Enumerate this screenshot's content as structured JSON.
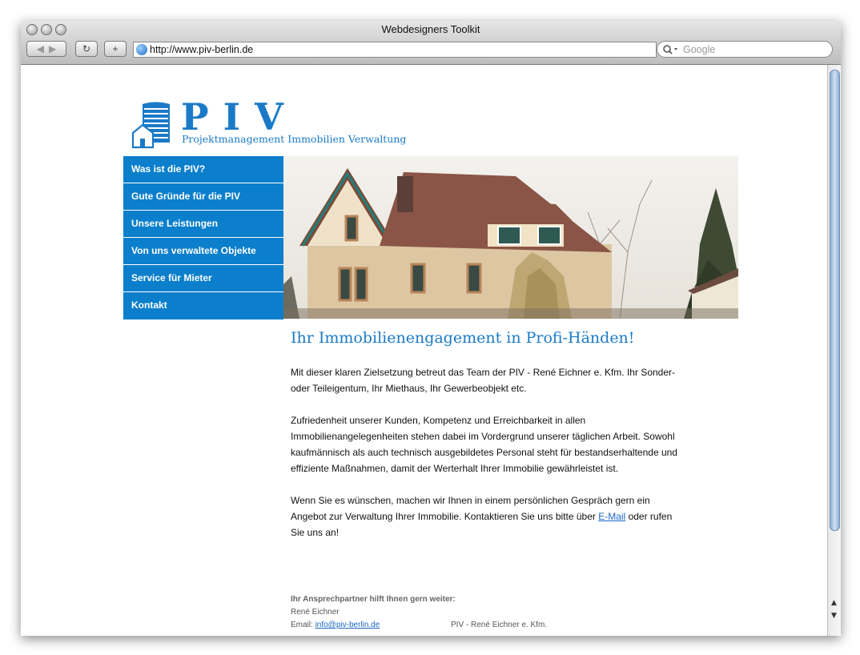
{
  "window": {
    "title": "Webdesigners Toolkit"
  },
  "toolbar": {
    "back_label": "◀",
    "forward_label": "▶",
    "reload_label": "↻",
    "add_label": "+",
    "url": "http://www.piv-berlin.de",
    "search_placeholder": "Google"
  },
  "logo": {
    "name": "PIV",
    "subtitle": "Projektmanagement Immobilien Verwaltung"
  },
  "nav": {
    "items": [
      {
        "label": "Was ist die PIV?"
      },
      {
        "label": "Gute Gründe für die PIV"
      },
      {
        "label": "Unsere Leistungen"
      },
      {
        "label": "Von uns verwaltete Objekte"
      },
      {
        "label": "Service für Mieter"
      },
      {
        "label": "Kontakt"
      }
    ]
  },
  "main": {
    "headline": "Ihr Immobilienengagement in Profi-Händen!",
    "para1": "Mit dieser klaren Zielsetzung betreut das Team der PIV - René Eichner e. Kfm. Ihr Sonder- oder Teileigentum, Ihr Miethaus, Ihr Gewerbeobjekt etc.",
    "para2": "Zufriedenheit unserer Kunden, Kompetenz und Erreichbarkeit in allen Immobilienangelegenheiten stehen dabei im Vordergrund unserer täglichen Arbeit. Sowohl kaufmännisch als auch technisch ausgebildetes Personal steht für bestandserhaltende und effiziente Maßnahmen, damit der Werterhalt Ihrer Immobilie gewährleistet ist.",
    "para3_before": "Wenn Sie es wünschen, machen wir Ihnen in einem persönlichen Gespräch gern ein Angebot zur Verwaltung Ihrer Immobilie. Kontaktieren Sie uns bitte über ",
    "para3_link": "E-Mail",
    "para3_after": " oder rufen Sie uns an!"
  },
  "contact": {
    "heading": "Ihr Ansprechpartner hilft Ihnen gern weiter:",
    "name": "René Eichner",
    "email_label": "Email: ",
    "email": "info@piv-berlin.de",
    "company": "PIV - René Eichner e. Kfm."
  },
  "colors": {
    "brand_blue": "#0b7fcc"
  }
}
